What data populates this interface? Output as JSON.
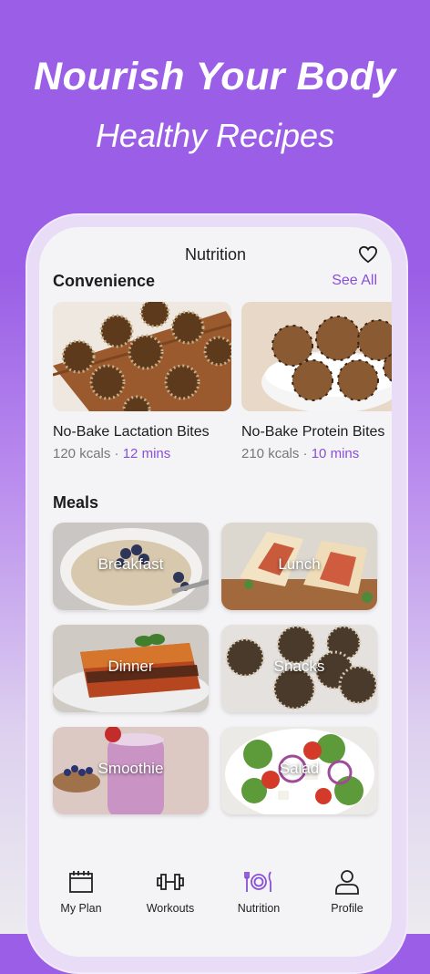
{
  "hero": {
    "title": "Nourish Your Body",
    "subtitle": "Healthy Recipes"
  },
  "header": {
    "title": "Nutrition",
    "favorite_icon": "heart-icon"
  },
  "convenience": {
    "title": "Convenience",
    "see_all": "See All",
    "items": [
      {
        "name": "No-Bake Lactation Bites",
        "kcals": "120 kcals",
        "sep": "·",
        "time": "12 mins"
      },
      {
        "name": "No-Bake Protein Bites",
        "kcals": "210 kcals",
        "sep": "·",
        "time": "10 mins"
      }
    ]
  },
  "meals": {
    "title": "Meals",
    "items": [
      {
        "label": "Breakfast"
      },
      {
        "label": "Lunch"
      },
      {
        "label": "Dinner"
      },
      {
        "label": "Snacks"
      },
      {
        "label": "Smoothie"
      },
      {
        "label": "Salad"
      }
    ]
  },
  "tabs": [
    {
      "label": "My Plan",
      "icon": "calendar-icon",
      "active": false
    },
    {
      "label": "Workouts",
      "icon": "dumbbell-icon",
      "active": false
    },
    {
      "label": "Nutrition",
      "icon": "plate-cutlery-icon",
      "active": true
    },
    {
      "label": "Profile",
      "icon": "person-icon",
      "active": false
    }
  ],
  "colors": {
    "accent": "#8a4fd8",
    "hero_bg": "#9a5fe6",
    "text": "#1c1c1c",
    "muted": "#777777"
  }
}
